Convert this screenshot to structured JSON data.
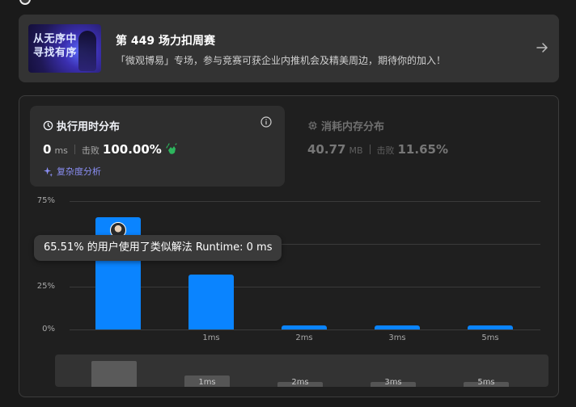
{
  "banner": {
    "thumb_line1": "从无序中",
    "thumb_line2": "寻找有序",
    "title": "第 449 场力扣周赛",
    "description": "「微观博易」专场，参与竞赛可获企业内推机会及精美周边，期待你的加入！"
  },
  "runtime_card": {
    "title": "执行用时分布",
    "value": "0",
    "unit": "ms",
    "beat_label": "击败",
    "beat_value": "100.00%",
    "complexity_label": "复杂度分析"
  },
  "memory_card": {
    "title": "消耗内存分布",
    "value": "40.77",
    "unit": "MB",
    "beat_label": "击败",
    "beat_value": "11.65%"
  },
  "tooltip": {
    "text": "65.51% 的用户使用了类似解法 Runtime: 0 ms"
  },
  "colors": {
    "bar": "#0a84ff",
    "accent_link": "#8b8ff5",
    "clap": "#2db55d"
  },
  "chart_data": {
    "type": "bar",
    "categories": [
      "0ms",
      "1ms",
      "2ms",
      "3ms",
      "5ms"
    ],
    "x_tick_labels": [
      "",
      "1ms",
      "2ms",
      "3ms",
      "5ms"
    ],
    "values": [
      65.51,
      32,
      2,
      2,
      2
    ],
    "y_ticks": [
      "0%",
      "25%",
      "75%"
    ],
    "ylim": [
      0,
      75
    ],
    "grid": true,
    "highlighted_category": "0ms"
  },
  "brush": {
    "labels": [
      "1ms",
      "2ms",
      "3ms",
      "5ms"
    ]
  }
}
